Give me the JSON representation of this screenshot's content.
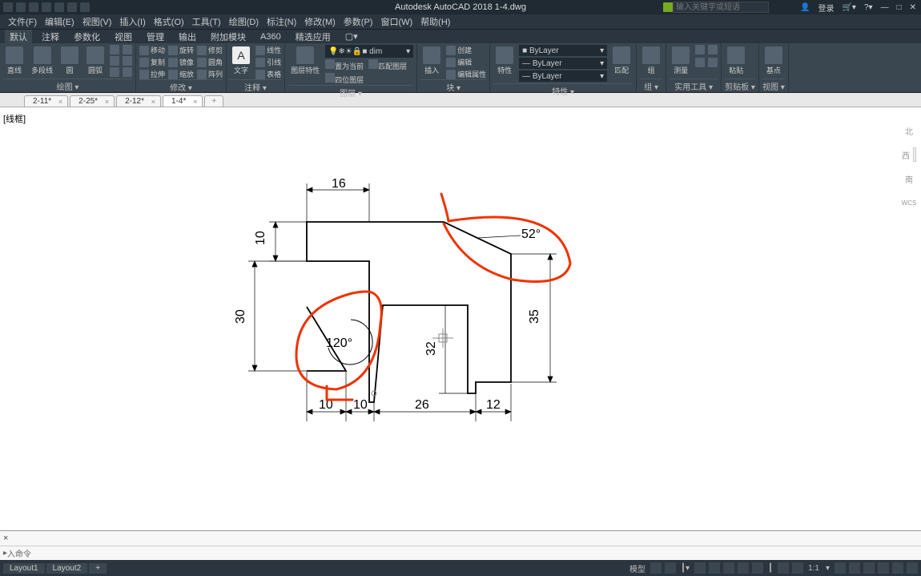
{
  "title": "Autodesk AutoCAD 2018    1-4.dwg",
  "search_placeholder": "输入关键字或短语",
  "login": "登录",
  "menu": [
    "文件(F)",
    "编辑(E)",
    "视图(V)",
    "插入(I)",
    "格式(O)",
    "工具(T)",
    "绘图(D)",
    "标注(N)",
    "修改(M)",
    "参数(P)",
    "窗口(W)",
    "帮助(H)"
  ],
  "tabs": [
    "默认",
    "注释",
    "参数化",
    "视图",
    "管理",
    "输出",
    "附加模块",
    "A360",
    "精选应用"
  ],
  "panels": {
    "draw": {
      "big1": "直线",
      "big2": "多段线",
      "big3": "圆",
      "big4": "圆弧",
      "label": "绘图 ▾"
    },
    "modify": {
      "items": [
        "移动",
        "旋转",
        "修剪",
        "复制",
        "镜像",
        "圆角",
        "拉伸",
        "缩放",
        "阵列"
      ],
      "label": "修改 ▾"
    },
    "annot": {
      "big": "文字",
      "lin": "线性",
      "lead": "引线",
      "tbl": "表格",
      "label": "注释 ▾"
    },
    "layer": {
      "big": "图层特性",
      "combo": "dim",
      "i": [
        "置为当前",
        "匹配图层",
        "四位图层"
      ],
      "label": "图层 ▾"
    },
    "block": {
      "big": "插入",
      "i": [
        "创建",
        "编辑",
        "编辑属性"
      ],
      "label": "块 ▾"
    },
    "props": {
      "big": "特性",
      "combos": [
        "ByLayer",
        "ByLayer",
        "ByLayer"
      ],
      "match": "匹配",
      "label": "特性 ▾"
    },
    "group": {
      "big": "组",
      "label": "组 ▾"
    },
    "util": {
      "big": "测量",
      "label": "实用工具 ▾"
    },
    "clip": {
      "big": "粘贴",
      "label": "剪贴板 ▾"
    },
    "view": {
      "big": "基点",
      "label": "视图 ▾"
    }
  },
  "filetabs": [
    "2-11*",
    "2-25*",
    "2-12*",
    "1-4*"
  ],
  "canvas_label": "[线框]",
  "nav": {
    "n": "北",
    "w": "西",
    "s": "南",
    "wcs": "WCS"
  },
  "dims": {
    "d16": "16",
    "d10v": "10",
    "d30": "30",
    "d52": "52°",
    "d35": "35",
    "d120": "120°",
    "d32": "32",
    "d10a": "10",
    "d10b": "10",
    "d26": "26",
    "d12": "12"
  },
  "cmd_hist": "",
  "cmd_prompt": "入命令",
  "layouts": [
    "Layout1",
    "Layout2"
  ],
  "status": {
    "model": "模型",
    "scale": "1:1"
  }
}
